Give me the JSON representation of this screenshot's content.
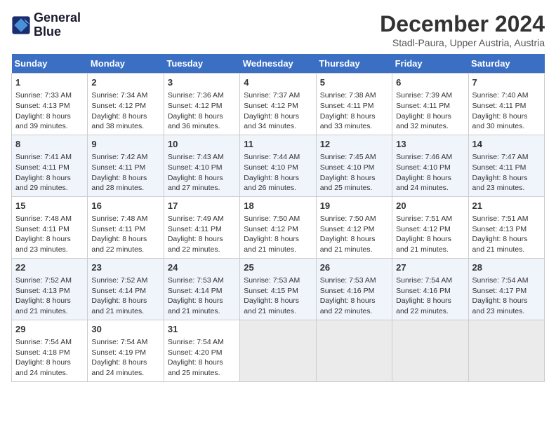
{
  "logo": {
    "line1": "General",
    "line2": "Blue"
  },
  "title": "December 2024",
  "location": "Stadl-Paura, Upper Austria, Austria",
  "days_header": [
    "Sunday",
    "Monday",
    "Tuesday",
    "Wednesday",
    "Thursday",
    "Friday",
    "Saturday"
  ],
  "weeks": [
    [
      {
        "day": "1",
        "sunrise": "7:33 AM",
        "sunset": "4:13 PM",
        "daylight": "8 hours and 39 minutes."
      },
      {
        "day": "2",
        "sunrise": "7:34 AM",
        "sunset": "4:12 PM",
        "daylight": "8 hours and 38 minutes."
      },
      {
        "day": "3",
        "sunrise": "7:36 AM",
        "sunset": "4:12 PM",
        "daylight": "8 hours and 36 minutes."
      },
      {
        "day": "4",
        "sunrise": "7:37 AM",
        "sunset": "4:12 PM",
        "daylight": "8 hours and 34 minutes."
      },
      {
        "day": "5",
        "sunrise": "7:38 AM",
        "sunset": "4:11 PM",
        "daylight": "8 hours and 33 minutes."
      },
      {
        "day": "6",
        "sunrise": "7:39 AM",
        "sunset": "4:11 PM",
        "daylight": "8 hours and 32 minutes."
      },
      {
        "day": "7",
        "sunrise": "7:40 AM",
        "sunset": "4:11 PM",
        "daylight": "8 hours and 30 minutes."
      }
    ],
    [
      {
        "day": "8",
        "sunrise": "7:41 AM",
        "sunset": "4:11 PM",
        "daylight": "8 hours and 29 minutes."
      },
      {
        "day": "9",
        "sunrise": "7:42 AM",
        "sunset": "4:11 PM",
        "daylight": "8 hours and 28 minutes."
      },
      {
        "day": "10",
        "sunrise": "7:43 AM",
        "sunset": "4:10 PM",
        "daylight": "8 hours and 27 minutes."
      },
      {
        "day": "11",
        "sunrise": "7:44 AM",
        "sunset": "4:10 PM",
        "daylight": "8 hours and 26 minutes."
      },
      {
        "day": "12",
        "sunrise": "7:45 AM",
        "sunset": "4:10 PM",
        "daylight": "8 hours and 25 minutes."
      },
      {
        "day": "13",
        "sunrise": "7:46 AM",
        "sunset": "4:10 PM",
        "daylight": "8 hours and 24 minutes."
      },
      {
        "day": "14",
        "sunrise": "7:47 AM",
        "sunset": "4:11 PM",
        "daylight": "8 hours and 23 minutes."
      }
    ],
    [
      {
        "day": "15",
        "sunrise": "7:48 AM",
        "sunset": "4:11 PM",
        "daylight": "8 hours and 23 minutes."
      },
      {
        "day": "16",
        "sunrise": "7:48 AM",
        "sunset": "4:11 PM",
        "daylight": "8 hours and 22 minutes."
      },
      {
        "day": "17",
        "sunrise": "7:49 AM",
        "sunset": "4:11 PM",
        "daylight": "8 hours and 22 minutes."
      },
      {
        "day": "18",
        "sunrise": "7:50 AM",
        "sunset": "4:12 PM",
        "daylight": "8 hours and 21 minutes."
      },
      {
        "day": "19",
        "sunrise": "7:50 AM",
        "sunset": "4:12 PM",
        "daylight": "8 hours and 21 minutes."
      },
      {
        "day": "20",
        "sunrise": "7:51 AM",
        "sunset": "4:12 PM",
        "daylight": "8 hours and 21 minutes."
      },
      {
        "day": "21",
        "sunrise": "7:51 AM",
        "sunset": "4:13 PM",
        "daylight": "8 hours and 21 minutes."
      }
    ],
    [
      {
        "day": "22",
        "sunrise": "7:52 AM",
        "sunset": "4:13 PM",
        "daylight": "8 hours and 21 minutes."
      },
      {
        "day": "23",
        "sunrise": "7:52 AM",
        "sunset": "4:14 PM",
        "daylight": "8 hours and 21 minutes."
      },
      {
        "day": "24",
        "sunrise": "7:53 AM",
        "sunset": "4:14 PM",
        "daylight": "8 hours and 21 minutes."
      },
      {
        "day": "25",
        "sunrise": "7:53 AM",
        "sunset": "4:15 PM",
        "daylight": "8 hours and 21 minutes."
      },
      {
        "day": "26",
        "sunrise": "7:53 AM",
        "sunset": "4:16 PM",
        "daylight": "8 hours and 22 minutes."
      },
      {
        "day": "27",
        "sunrise": "7:54 AM",
        "sunset": "4:16 PM",
        "daylight": "8 hours and 22 minutes."
      },
      {
        "day": "28",
        "sunrise": "7:54 AM",
        "sunset": "4:17 PM",
        "daylight": "8 hours and 23 minutes."
      }
    ],
    [
      {
        "day": "29",
        "sunrise": "7:54 AM",
        "sunset": "4:18 PM",
        "daylight": "8 hours and 24 minutes."
      },
      {
        "day": "30",
        "sunrise": "7:54 AM",
        "sunset": "4:19 PM",
        "daylight": "8 hours and 24 minutes."
      },
      {
        "day": "31",
        "sunrise": "7:54 AM",
        "sunset": "4:20 PM",
        "daylight": "8 hours and 25 minutes."
      },
      null,
      null,
      null,
      null
    ]
  ],
  "labels": {
    "sunrise_prefix": "Sunrise: ",
    "sunset_prefix": "Sunset: ",
    "daylight_prefix": "Daylight: "
  }
}
